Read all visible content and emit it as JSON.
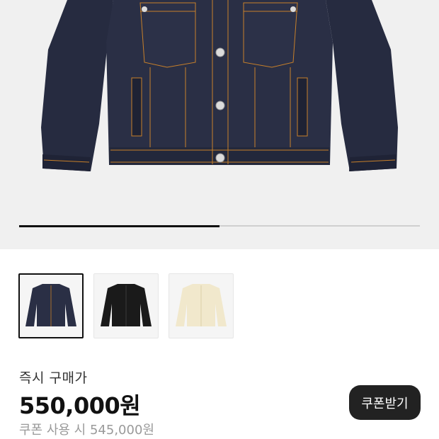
{
  "gallery": {
    "current_slide_fraction": 0.5,
    "thumbnails": [
      {
        "color_name": "indigo",
        "color": "#2a2f45",
        "selected": true
      },
      {
        "color_name": "black",
        "color": "#1a1a1a",
        "selected": false
      },
      {
        "color_name": "ecru",
        "color": "#f1e8cc",
        "selected": false
      }
    ]
  },
  "purchase": {
    "instant_label": "즉시 구매가",
    "price": "550,000원",
    "coupon_price_text": "쿠폰 사용 시 545,000원",
    "coupon_button_label": "쿠폰받기"
  }
}
